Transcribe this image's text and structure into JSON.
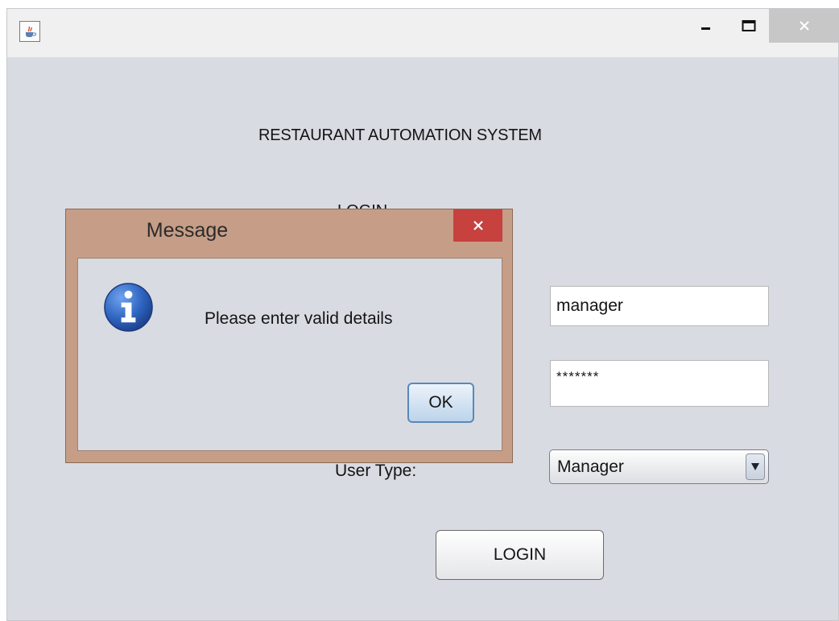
{
  "window": {
    "icon": "java-cup-icon",
    "buttons": {
      "minimize": "minimize-icon",
      "maximize": "maximize-icon",
      "close": "close-icon"
    }
  },
  "main": {
    "title": "RESTAURANT AUTOMATION SYSTEM",
    "login_heading": "LOGIN",
    "username_value": "manager",
    "password_value": "*******",
    "user_type_label": "User Type:",
    "user_type_selected": "Manager",
    "login_button": "LOGIN"
  },
  "dialog": {
    "title": "Message",
    "message": "Please enter valid details",
    "ok_button": "OK",
    "icon": "info-icon"
  },
  "colors": {
    "dialog_frame": "#c69d86",
    "dialog_close": "#c7413f",
    "window_bg": "#d9dbe2",
    "info_icon_blue": "#2e64c0"
  }
}
